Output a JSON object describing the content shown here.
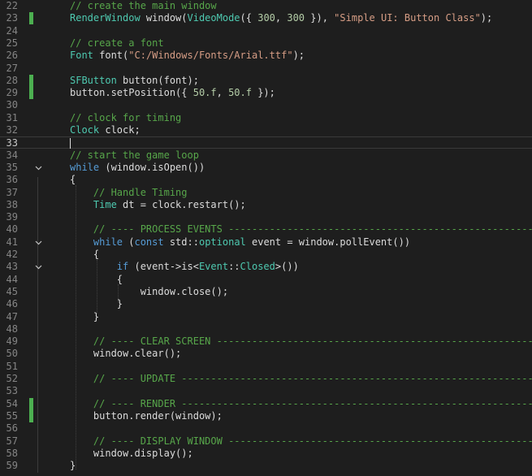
{
  "editor": {
    "lines": [
      {
        "n": "22",
        "mark": false,
        "fold": false,
        "tokens": [
          {
            "t": "// create the main window",
            "c": "comment"
          }
        ]
      },
      {
        "n": "23",
        "mark": true,
        "fold": false,
        "tokens": [
          {
            "t": "RenderWindow",
            "c": "type"
          },
          {
            "t": " window(",
            "c": "plain"
          },
          {
            "t": "VideoMode",
            "c": "type"
          },
          {
            "t": "({ ",
            "c": "plain"
          },
          {
            "t": "300",
            "c": "num"
          },
          {
            "t": ", ",
            "c": "plain"
          },
          {
            "t": "300",
            "c": "num"
          },
          {
            "t": " }), ",
            "c": "plain"
          },
          {
            "t": "\"Simple UI: Button Class\"",
            "c": "string"
          },
          {
            "t": ");",
            "c": "plain"
          }
        ]
      },
      {
        "n": "24",
        "mark": false,
        "fold": false,
        "tokens": []
      },
      {
        "n": "25",
        "mark": false,
        "fold": false,
        "tokens": [
          {
            "t": "// create a font",
            "c": "comment"
          }
        ]
      },
      {
        "n": "26",
        "mark": false,
        "fold": false,
        "tokens": [
          {
            "t": "Font",
            "c": "type"
          },
          {
            "t": " font(",
            "c": "plain"
          },
          {
            "t": "\"C:/Windows/Fonts/Arial.ttf\"",
            "c": "string"
          },
          {
            "t": ");",
            "c": "plain"
          }
        ]
      },
      {
        "n": "27",
        "mark": false,
        "fold": false,
        "tokens": []
      },
      {
        "n": "28",
        "mark": true,
        "fold": false,
        "tokens": [
          {
            "t": "SFButton",
            "c": "type"
          },
          {
            "t": " button(font);",
            "c": "plain"
          }
        ]
      },
      {
        "n": "29",
        "mark": true,
        "fold": false,
        "tokens": [
          {
            "t": "button.setPosition({ ",
            "c": "plain"
          },
          {
            "t": "50.f",
            "c": "num"
          },
          {
            "t": ", ",
            "c": "plain"
          },
          {
            "t": "50.f",
            "c": "num"
          },
          {
            "t": " });",
            "c": "plain"
          }
        ]
      },
      {
        "n": "30",
        "mark": false,
        "fold": false,
        "tokens": []
      },
      {
        "n": "31",
        "mark": false,
        "fold": false,
        "tokens": [
          {
            "t": "// clock for timing",
            "c": "comment"
          }
        ]
      },
      {
        "n": "32",
        "mark": false,
        "fold": false,
        "tokens": [
          {
            "t": "Clock",
            "c": "type"
          },
          {
            "t": " clock;",
            "c": "plain"
          }
        ]
      },
      {
        "n": "33",
        "mark": false,
        "fold": false,
        "current": true,
        "tokens": []
      },
      {
        "n": "34",
        "mark": false,
        "fold": false,
        "tokens": [
          {
            "t": "// start the game loop",
            "c": "comment"
          }
        ]
      },
      {
        "n": "35",
        "mark": false,
        "fold": true,
        "tokens": [
          {
            "t": "while",
            "c": "kw"
          },
          {
            "t": " (window.isOpen())",
            "c": "plain"
          }
        ]
      },
      {
        "n": "36",
        "mark": false,
        "fold": false,
        "tokens": [
          {
            "t": "{",
            "c": "plain"
          }
        ]
      },
      {
        "n": "37",
        "mark": false,
        "fold": false,
        "tokens": [
          {
            "t": "    ",
            "c": "plain"
          },
          {
            "t": "// Handle Timing",
            "c": "comment"
          }
        ]
      },
      {
        "n": "38",
        "mark": false,
        "fold": false,
        "tokens": [
          {
            "t": "    ",
            "c": "plain"
          },
          {
            "t": "Time",
            "c": "type"
          },
          {
            "t": " dt = clock.restart();",
            "c": "plain"
          }
        ]
      },
      {
        "n": "39",
        "mark": false,
        "fold": false,
        "tokens": []
      },
      {
        "n": "40",
        "mark": false,
        "fold": false,
        "tokens": [
          {
            "t": "    ",
            "c": "plain"
          },
          {
            "t": "// ---- PROCESS EVENTS ---------------------------------------------------- //",
            "c": "comment"
          }
        ]
      },
      {
        "n": "41",
        "mark": false,
        "fold": true,
        "tokens": [
          {
            "t": "    ",
            "c": "plain"
          },
          {
            "t": "while",
            "c": "kw"
          },
          {
            "t": " (",
            "c": "plain"
          },
          {
            "t": "const",
            "c": "kw"
          },
          {
            "t": " std::",
            "c": "plain"
          },
          {
            "t": "optional",
            "c": "type"
          },
          {
            "t": " event = window.pollEvent())",
            "c": "plain"
          }
        ]
      },
      {
        "n": "42",
        "mark": false,
        "fold": false,
        "tokens": [
          {
            "t": "    {",
            "c": "plain"
          }
        ]
      },
      {
        "n": "43",
        "mark": false,
        "fold": true,
        "tokens": [
          {
            "t": "        ",
            "c": "plain"
          },
          {
            "t": "if",
            "c": "kw"
          },
          {
            "t": " (event->is<",
            "c": "plain"
          },
          {
            "t": "Event",
            "c": "type"
          },
          {
            "t": "::",
            "c": "plain"
          },
          {
            "t": "Closed",
            "c": "type"
          },
          {
            "t": ">())",
            "c": "plain"
          }
        ]
      },
      {
        "n": "44",
        "mark": false,
        "fold": false,
        "tokens": [
          {
            "t": "        {",
            "c": "plain"
          }
        ]
      },
      {
        "n": "45",
        "mark": false,
        "fold": false,
        "tokens": [
          {
            "t": "            window.close();",
            "c": "plain"
          }
        ]
      },
      {
        "n": "46",
        "mark": false,
        "fold": false,
        "tokens": [
          {
            "t": "        }",
            "c": "plain"
          }
        ]
      },
      {
        "n": "47",
        "mark": false,
        "fold": false,
        "tokens": [
          {
            "t": "    }",
            "c": "plain"
          }
        ]
      },
      {
        "n": "48",
        "mark": false,
        "fold": false,
        "tokens": []
      },
      {
        "n": "49",
        "mark": false,
        "fold": false,
        "tokens": [
          {
            "t": "    ",
            "c": "plain"
          },
          {
            "t": "// ---- CLEAR SCREEN ------------------------------------------------------ //",
            "c": "comment"
          }
        ]
      },
      {
        "n": "50",
        "mark": false,
        "fold": false,
        "tokens": [
          {
            "t": "    window.clear();",
            "c": "plain"
          }
        ]
      },
      {
        "n": "51",
        "mark": false,
        "fold": false,
        "tokens": []
      },
      {
        "n": "52",
        "mark": false,
        "fold": false,
        "tokens": [
          {
            "t": "    ",
            "c": "plain"
          },
          {
            "t": "// ---- UPDATE ------------------------------------------------------------ //",
            "c": "comment"
          }
        ]
      },
      {
        "n": "53",
        "mark": false,
        "fold": false,
        "tokens": []
      },
      {
        "n": "54",
        "mark": true,
        "fold": false,
        "tokens": [
          {
            "t": "    ",
            "c": "plain"
          },
          {
            "t": "// ---- RENDER ------------------------------------------------------------ //",
            "c": "comment"
          }
        ]
      },
      {
        "n": "55",
        "mark": true,
        "fold": false,
        "tokens": [
          {
            "t": "    button.render(window);",
            "c": "plain"
          }
        ]
      },
      {
        "n": "56",
        "mark": false,
        "fold": false,
        "tokens": []
      },
      {
        "n": "57",
        "mark": false,
        "fold": false,
        "tokens": [
          {
            "t": "    ",
            "c": "plain"
          },
          {
            "t": "// ---- DISPLAY WINDOW ---------------------------------------------------- //",
            "c": "comment"
          }
        ]
      },
      {
        "n": "58",
        "mark": false,
        "fold": false,
        "tokens": [
          {
            "t": "    window.display();",
            "c": "plain"
          }
        ]
      },
      {
        "n": "59",
        "mark": false,
        "fold": false,
        "tokens": [
          {
            "t": "}",
            "c": "plain"
          }
        ]
      }
    ]
  },
  "colors": {
    "background": "#1e1e1e",
    "comment": "#57a64a",
    "keyword": "#569cd6",
    "type": "#4ec9b0",
    "string": "#d69d85",
    "number": "#b5cea8",
    "plain": "#dcdcdc",
    "line_number": "#858585",
    "change_marker": "#4caf50"
  },
  "icons": {
    "fold": "chevron-down-icon"
  }
}
